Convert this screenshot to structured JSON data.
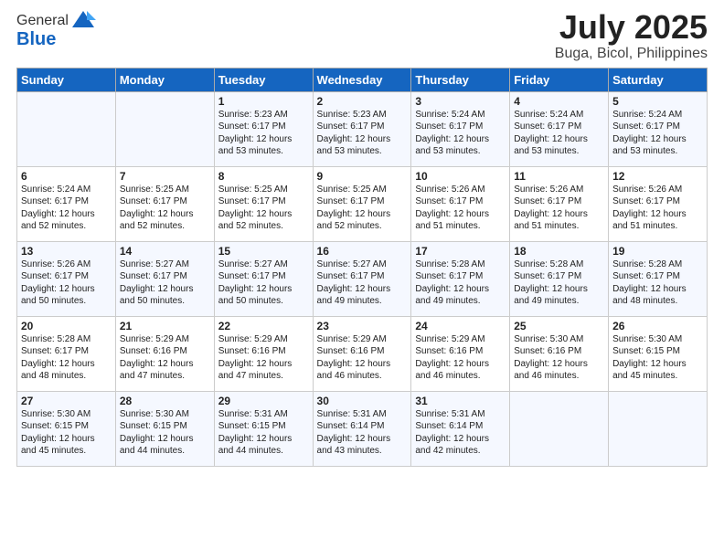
{
  "header": {
    "logo_general": "General",
    "logo_blue": "Blue",
    "title": "July 2025",
    "subtitle": "Buga, Bicol, Philippines"
  },
  "weekdays": [
    "Sunday",
    "Monday",
    "Tuesday",
    "Wednesday",
    "Thursday",
    "Friday",
    "Saturday"
  ],
  "weeks": [
    [
      {
        "day": "",
        "info": ""
      },
      {
        "day": "",
        "info": ""
      },
      {
        "day": "1",
        "info": "Sunrise: 5:23 AM\nSunset: 6:17 PM\nDaylight: 12 hours\nand 53 minutes."
      },
      {
        "day": "2",
        "info": "Sunrise: 5:23 AM\nSunset: 6:17 PM\nDaylight: 12 hours\nand 53 minutes."
      },
      {
        "day": "3",
        "info": "Sunrise: 5:24 AM\nSunset: 6:17 PM\nDaylight: 12 hours\nand 53 minutes."
      },
      {
        "day": "4",
        "info": "Sunrise: 5:24 AM\nSunset: 6:17 PM\nDaylight: 12 hours\nand 53 minutes."
      },
      {
        "day": "5",
        "info": "Sunrise: 5:24 AM\nSunset: 6:17 PM\nDaylight: 12 hours\nand 53 minutes."
      }
    ],
    [
      {
        "day": "6",
        "info": "Sunrise: 5:24 AM\nSunset: 6:17 PM\nDaylight: 12 hours\nand 52 minutes."
      },
      {
        "day": "7",
        "info": "Sunrise: 5:25 AM\nSunset: 6:17 PM\nDaylight: 12 hours\nand 52 minutes."
      },
      {
        "day": "8",
        "info": "Sunrise: 5:25 AM\nSunset: 6:17 PM\nDaylight: 12 hours\nand 52 minutes."
      },
      {
        "day": "9",
        "info": "Sunrise: 5:25 AM\nSunset: 6:17 PM\nDaylight: 12 hours\nand 52 minutes."
      },
      {
        "day": "10",
        "info": "Sunrise: 5:26 AM\nSunset: 6:17 PM\nDaylight: 12 hours\nand 51 minutes."
      },
      {
        "day": "11",
        "info": "Sunrise: 5:26 AM\nSunset: 6:17 PM\nDaylight: 12 hours\nand 51 minutes."
      },
      {
        "day": "12",
        "info": "Sunrise: 5:26 AM\nSunset: 6:17 PM\nDaylight: 12 hours\nand 51 minutes."
      }
    ],
    [
      {
        "day": "13",
        "info": "Sunrise: 5:26 AM\nSunset: 6:17 PM\nDaylight: 12 hours\nand 50 minutes."
      },
      {
        "day": "14",
        "info": "Sunrise: 5:27 AM\nSunset: 6:17 PM\nDaylight: 12 hours\nand 50 minutes."
      },
      {
        "day": "15",
        "info": "Sunrise: 5:27 AM\nSunset: 6:17 PM\nDaylight: 12 hours\nand 50 minutes."
      },
      {
        "day": "16",
        "info": "Sunrise: 5:27 AM\nSunset: 6:17 PM\nDaylight: 12 hours\nand 49 minutes."
      },
      {
        "day": "17",
        "info": "Sunrise: 5:28 AM\nSunset: 6:17 PM\nDaylight: 12 hours\nand 49 minutes."
      },
      {
        "day": "18",
        "info": "Sunrise: 5:28 AM\nSunset: 6:17 PM\nDaylight: 12 hours\nand 49 minutes."
      },
      {
        "day": "19",
        "info": "Sunrise: 5:28 AM\nSunset: 6:17 PM\nDaylight: 12 hours\nand 48 minutes."
      }
    ],
    [
      {
        "day": "20",
        "info": "Sunrise: 5:28 AM\nSunset: 6:17 PM\nDaylight: 12 hours\nand 48 minutes."
      },
      {
        "day": "21",
        "info": "Sunrise: 5:29 AM\nSunset: 6:16 PM\nDaylight: 12 hours\nand 47 minutes."
      },
      {
        "day": "22",
        "info": "Sunrise: 5:29 AM\nSunset: 6:16 PM\nDaylight: 12 hours\nand 47 minutes."
      },
      {
        "day": "23",
        "info": "Sunrise: 5:29 AM\nSunset: 6:16 PM\nDaylight: 12 hours\nand 46 minutes."
      },
      {
        "day": "24",
        "info": "Sunrise: 5:29 AM\nSunset: 6:16 PM\nDaylight: 12 hours\nand 46 minutes."
      },
      {
        "day": "25",
        "info": "Sunrise: 5:30 AM\nSunset: 6:16 PM\nDaylight: 12 hours\nand 46 minutes."
      },
      {
        "day": "26",
        "info": "Sunrise: 5:30 AM\nSunset: 6:15 PM\nDaylight: 12 hours\nand 45 minutes."
      }
    ],
    [
      {
        "day": "27",
        "info": "Sunrise: 5:30 AM\nSunset: 6:15 PM\nDaylight: 12 hours\nand 45 minutes."
      },
      {
        "day": "28",
        "info": "Sunrise: 5:30 AM\nSunset: 6:15 PM\nDaylight: 12 hours\nand 44 minutes."
      },
      {
        "day": "29",
        "info": "Sunrise: 5:31 AM\nSunset: 6:15 PM\nDaylight: 12 hours\nand 44 minutes."
      },
      {
        "day": "30",
        "info": "Sunrise: 5:31 AM\nSunset: 6:14 PM\nDaylight: 12 hours\nand 43 minutes."
      },
      {
        "day": "31",
        "info": "Sunrise: 5:31 AM\nSunset: 6:14 PM\nDaylight: 12 hours\nand 42 minutes."
      },
      {
        "day": "",
        "info": ""
      },
      {
        "day": "",
        "info": ""
      }
    ]
  ]
}
